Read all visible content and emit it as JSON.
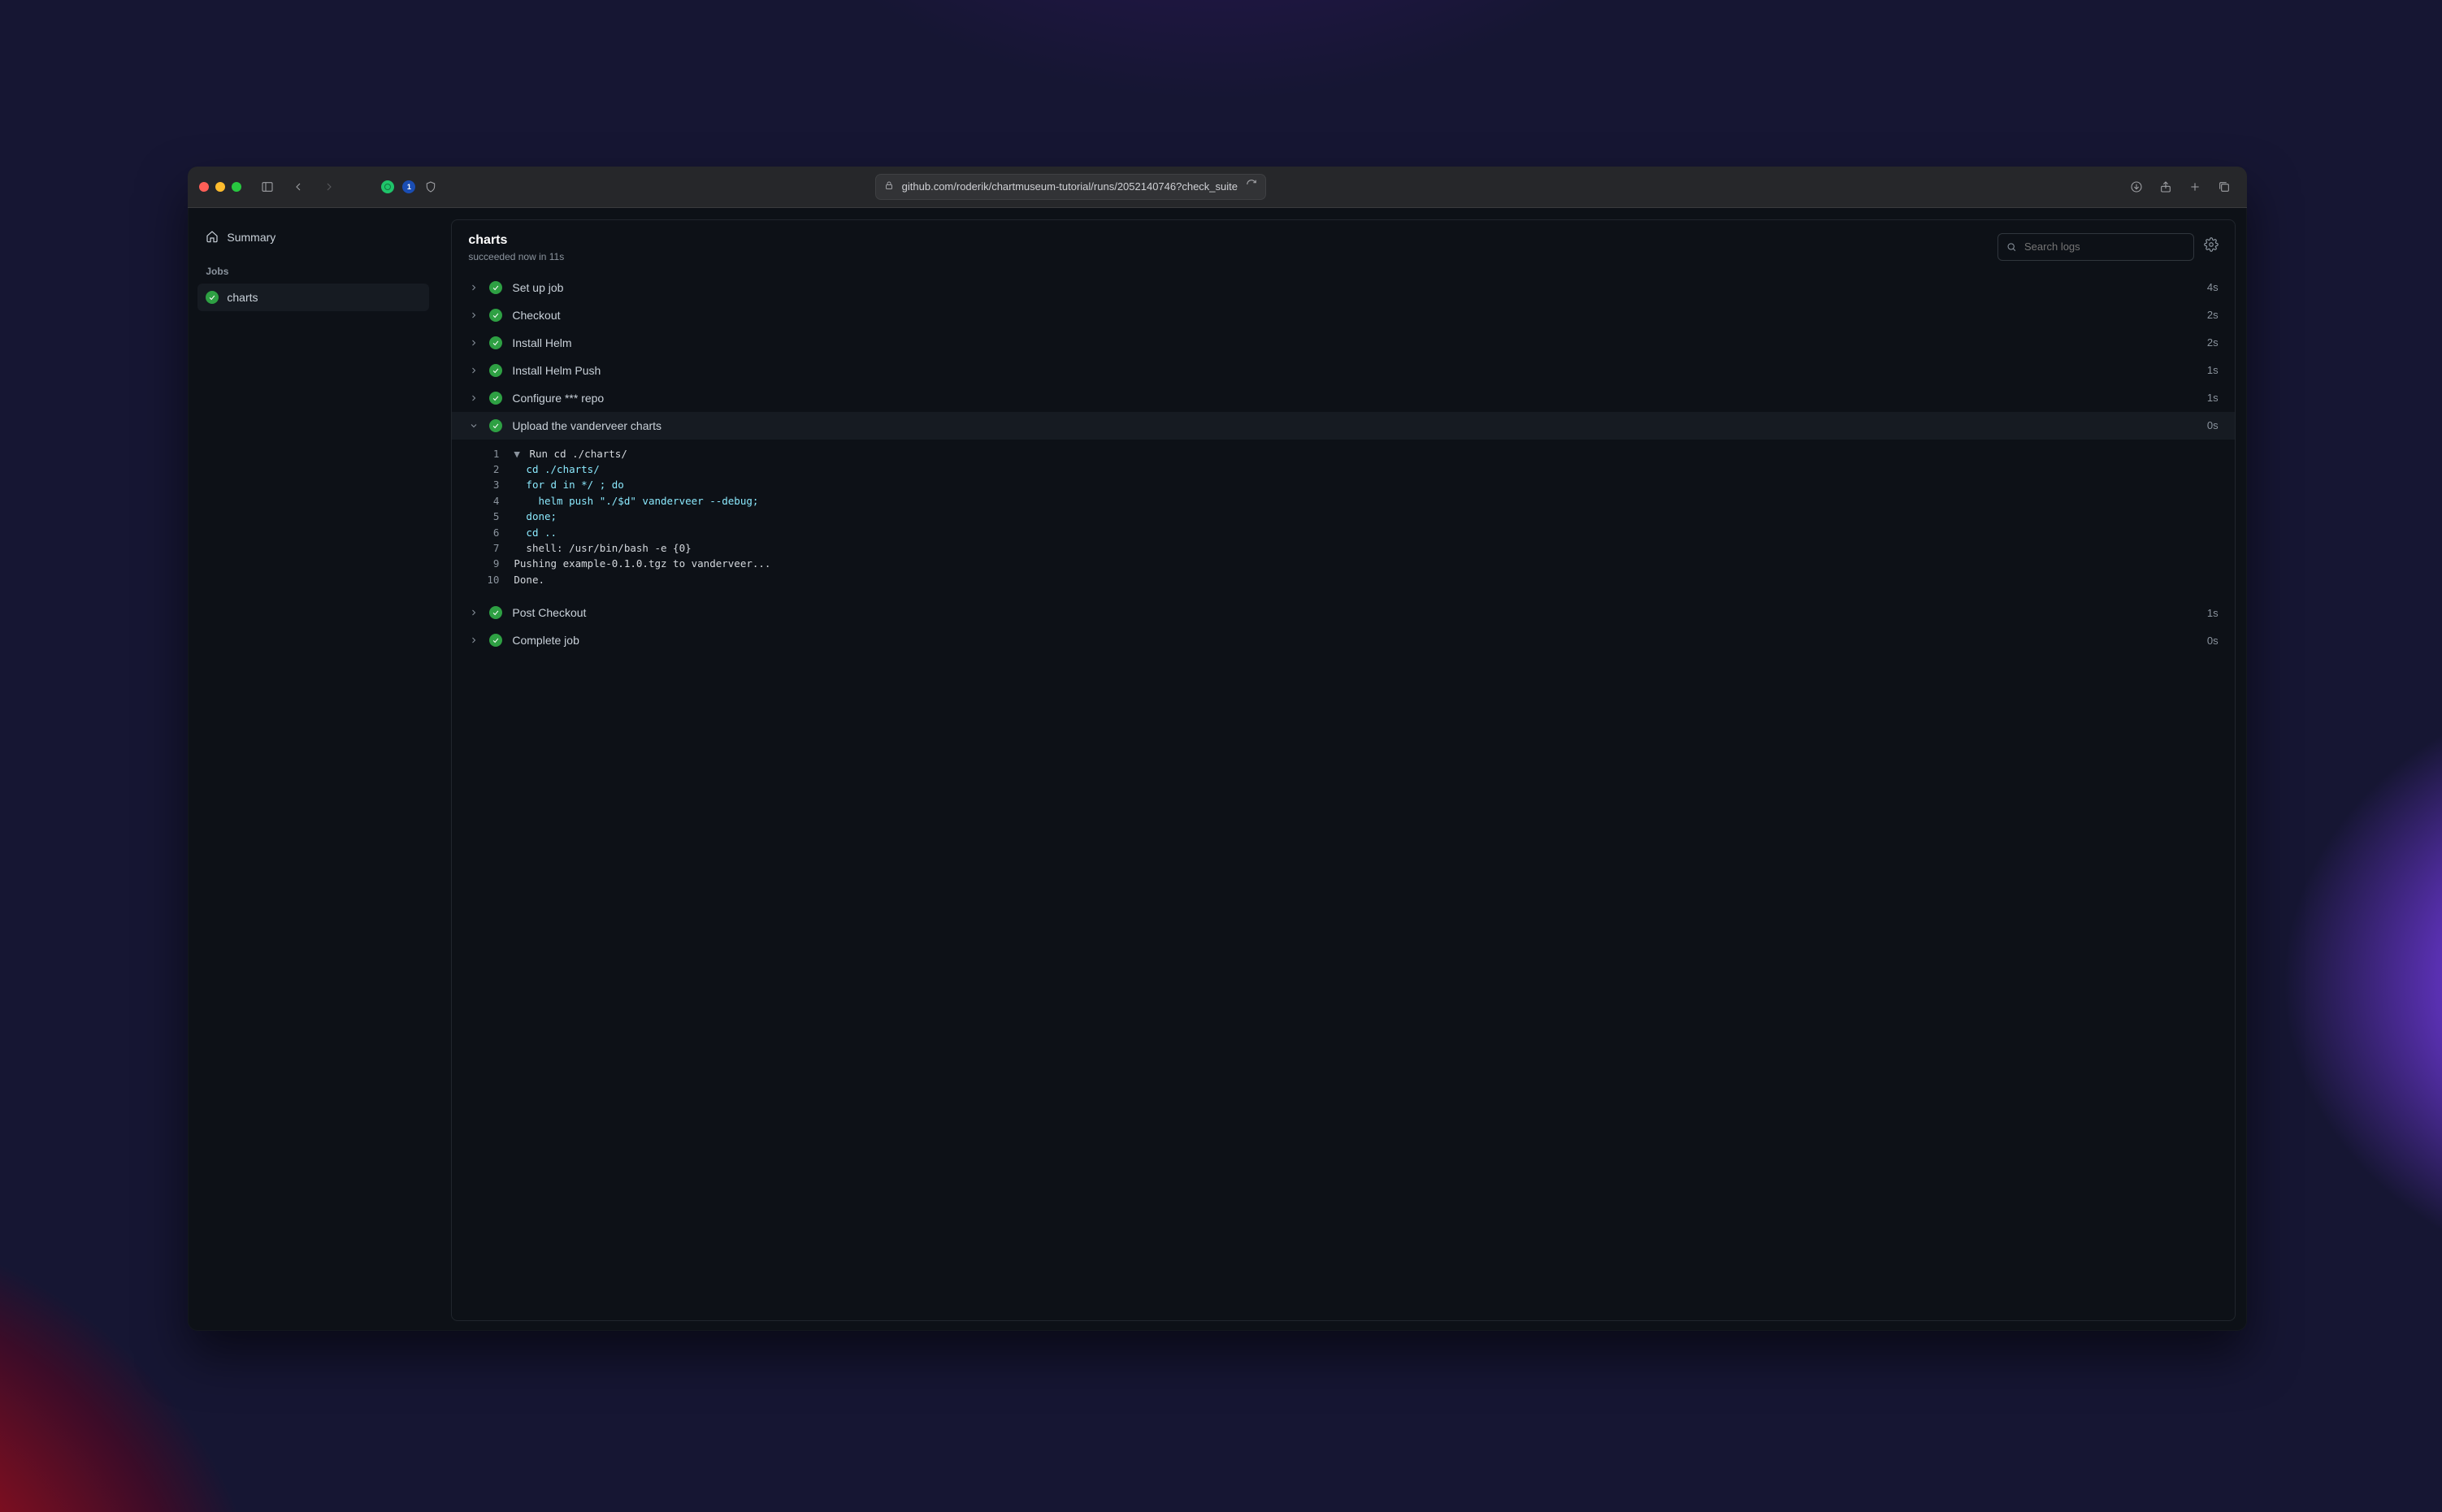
{
  "browser": {
    "url": "github.com/roderik/chartmuseum-tutorial/runs/2052140746?check_suite"
  },
  "sidebar": {
    "summary_label": "Summary",
    "jobs_label": "Jobs",
    "jobs": [
      {
        "name": "charts",
        "status": "success"
      }
    ]
  },
  "job": {
    "title": "charts",
    "subtitle": "succeeded now in 11s"
  },
  "search": {
    "placeholder": "Search logs"
  },
  "steps": [
    {
      "name": "Set up job",
      "duration": "4s",
      "status": "success",
      "expanded": false
    },
    {
      "name": "Checkout",
      "duration": "2s",
      "status": "success",
      "expanded": false
    },
    {
      "name": "Install Helm",
      "duration": "2s",
      "status": "success",
      "expanded": false
    },
    {
      "name": "Install Helm Push",
      "duration": "1s",
      "status": "success",
      "expanded": false
    },
    {
      "name": "Configure *** repo",
      "duration": "1s",
      "status": "success",
      "expanded": false
    },
    {
      "name": "Upload the vanderveer charts",
      "duration": "0s",
      "status": "success",
      "expanded": true,
      "log": [
        {
          "n": "1",
          "tri": true,
          "cls": "plain",
          "text": "Run cd ./charts/"
        },
        {
          "n": "2",
          "tri": false,
          "cls": "cmd",
          "text": "  cd ./charts/"
        },
        {
          "n": "3",
          "tri": false,
          "cls": "cmd",
          "text": "  for d in */ ; do"
        },
        {
          "n": "4",
          "tri": false,
          "cls": "cmd",
          "text": "    helm push \"./$d\" vanderveer --debug;"
        },
        {
          "n": "5",
          "tri": false,
          "cls": "cmd",
          "text": "  done;"
        },
        {
          "n": "6",
          "tri": false,
          "cls": "cmd",
          "text": "  cd .."
        },
        {
          "n": "7",
          "tri": false,
          "cls": "plain",
          "text": "  shell: /usr/bin/bash -e {0}"
        },
        {
          "n": "9",
          "tri": false,
          "cls": "plain",
          "text": "Pushing example-0.1.0.tgz to vanderveer..."
        },
        {
          "n": "10",
          "tri": false,
          "cls": "plain",
          "text": "Done."
        }
      ]
    },
    {
      "name": "Post Checkout",
      "duration": "1s",
      "status": "success",
      "expanded": false
    },
    {
      "name": "Complete job",
      "duration": "0s",
      "status": "success",
      "expanded": false
    }
  ]
}
